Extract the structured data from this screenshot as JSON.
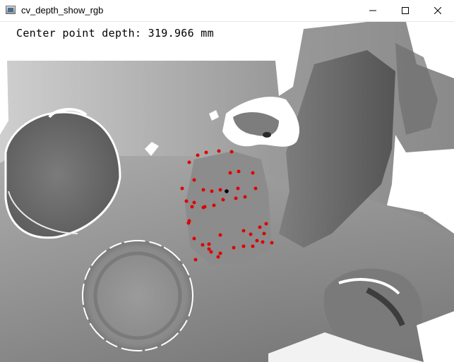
{
  "window": {
    "title": "cv_depth_show_rgb",
    "icon": "opencv-window-icon",
    "controls": [
      "minimize-icon",
      "maximize-icon",
      "close-icon"
    ]
  },
  "overlay": {
    "depth_text": "Center point depth: 319.966 mm"
  },
  "view": {
    "image_type": "grayscale depth map with detected keypoints",
    "keypoint_color": "#e00000",
    "center_point_color": "#000000"
  }
}
